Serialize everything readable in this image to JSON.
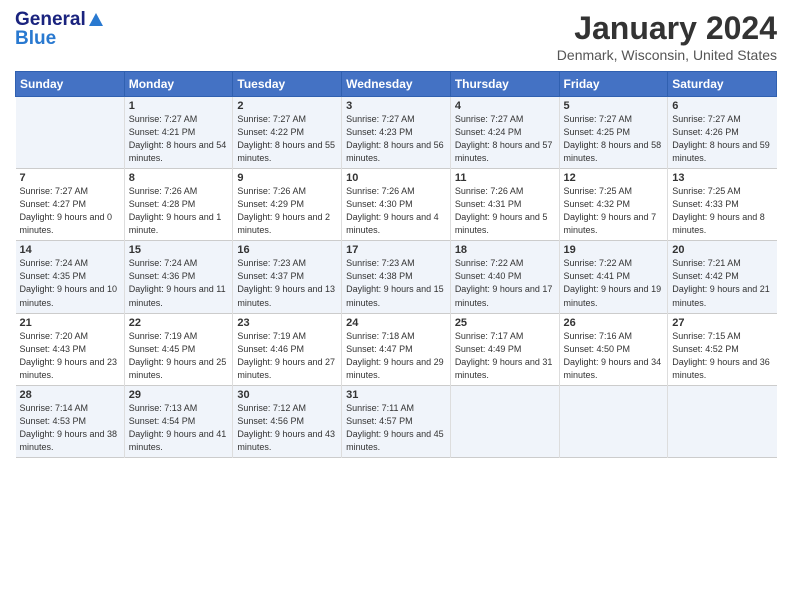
{
  "logo": {
    "line1": "General",
    "line2": "Blue"
  },
  "title": "January 2024",
  "subtitle": "Denmark, Wisconsin, United States",
  "days_header": [
    "Sunday",
    "Monday",
    "Tuesday",
    "Wednesday",
    "Thursday",
    "Friday",
    "Saturday"
  ],
  "weeks": [
    [
      {
        "num": "",
        "sunrise": "",
        "sunset": "",
        "daylight": ""
      },
      {
        "num": "1",
        "sunrise": "Sunrise: 7:27 AM",
        "sunset": "Sunset: 4:21 PM",
        "daylight": "Daylight: 8 hours and 54 minutes."
      },
      {
        "num": "2",
        "sunrise": "Sunrise: 7:27 AM",
        "sunset": "Sunset: 4:22 PM",
        "daylight": "Daylight: 8 hours and 55 minutes."
      },
      {
        "num": "3",
        "sunrise": "Sunrise: 7:27 AM",
        "sunset": "Sunset: 4:23 PM",
        "daylight": "Daylight: 8 hours and 56 minutes."
      },
      {
        "num": "4",
        "sunrise": "Sunrise: 7:27 AM",
        "sunset": "Sunset: 4:24 PM",
        "daylight": "Daylight: 8 hours and 57 minutes."
      },
      {
        "num": "5",
        "sunrise": "Sunrise: 7:27 AM",
        "sunset": "Sunset: 4:25 PM",
        "daylight": "Daylight: 8 hours and 58 minutes."
      },
      {
        "num": "6",
        "sunrise": "Sunrise: 7:27 AM",
        "sunset": "Sunset: 4:26 PM",
        "daylight": "Daylight: 8 hours and 59 minutes."
      }
    ],
    [
      {
        "num": "7",
        "sunrise": "Sunrise: 7:27 AM",
        "sunset": "Sunset: 4:27 PM",
        "daylight": "Daylight: 9 hours and 0 minutes."
      },
      {
        "num": "8",
        "sunrise": "Sunrise: 7:26 AM",
        "sunset": "Sunset: 4:28 PM",
        "daylight": "Daylight: 9 hours and 1 minute."
      },
      {
        "num": "9",
        "sunrise": "Sunrise: 7:26 AM",
        "sunset": "Sunset: 4:29 PM",
        "daylight": "Daylight: 9 hours and 2 minutes."
      },
      {
        "num": "10",
        "sunrise": "Sunrise: 7:26 AM",
        "sunset": "Sunset: 4:30 PM",
        "daylight": "Daylight: 9 hours and 4 minutes."
      },
      {
        "num": "11",
        "sunrise": "Sunrise: 7:26 AM",
        "sunset": "Sunset: 4:31 PM",
        "daylight": "Daylight: 9 hours and 5 minutes."
      },
      {
        "num": "12",
        "sunrise": "Sunrise: 7:25 AM",
        "sunset": "Sunset: 4:32 PM",
        "daylight": "Daylight: 9 hours and 7 minutes."
      },
      {
        "num": "13",
        "sunrise": "Sunrise: 7:25 AM",
        "sunset": "Sunset: 4:33 PM",
        "daylight": "Daylight: 9 hours and 8 minutes."
      }
    ],
    [
      {
        "num": "14",
        "sunrise": "Sunrise: 7:24 AM",
        "sunset": "Sunset: 4:35 PM",
        "daylight": "Daylight: 9 hours and 10 minutes."
      },
      {
        "num": "15",
        "sunrise": "Sunrise: 7:24 AM",
        "sunset": "Sunset: 4:36 PM",
        "daylight": "Daylight: 9 hours and 11 minutes."
      },
      {
        "num": "16",
        "sunrise": "Sunrise: 7:23 AM",
        "sunset": "Sunset: 4:37 PM",
        "daylight": "Daylight: 9 hours and 13 minutes."
      },
      {
        "num": "17",
        "sunrise": "Sunrise: 7:23 AM",
        "sunset": "Sunset: 4:38 PM",
        "daylight": "Daylight: 9 hours and 15 minutes."
      },
      {
        "num": "18",
        "sunrise": "Sunrise: 7:22 AM",
        "sunset": "Sunset: 4:40 PM",
        "daylight": "Daylight: 9 hours and 17 minutes."
      },
      {
        "num": "19",
        "sunrise": "Sunrise: 7:22 AM",
        "sunset": "Sunset: 4:41 PM",
        "daylight": "Daylight: 9 hours and 19 minutes."
      },
      {
        "num": "20",
        "sunrise": "Sunrise: 7:21 AM",
        "sunset": "Sunset: 4:42 PM",
        "daylight": "Daylight: 9 hours and 21 minutes."
      }
    ],
    [
      {
        "num": "21",
        "sunrise": "Sunrise: 7:20 AM",
        "sunset": "Sunset: 4:43 PM",
        "daylight": "Daylight: 9 hours and 23 minutes."
      },
      {
        "num": "22",
        "sunrise": "Sunrise: 7:19 AM",
        "sunset": "Sunset: 4:45 PM",
        "daylight": "Daylight: 9 hours and 25 minutes."
      },
      {
        "num": "23",
        "sunrise": "Sunrise: 7:19 AM",
        "sunset": "Sunset: 4:46 PM",
        "daylight": "Daylight: 9 hours and 27 minutes."
      },
      {
        "num": "24",
        "sunrise": "Sunrise: 7:18 AM",
        "sunset": "Sunset: 4:47 PM",
        "daylight": "Daylight: 9 hours and 29 minutes."
      },
      {
        "num": "25",
        "sunrise": "Sunrise: 7:17 AM",
        "sunset": "Sunset: 4:49 PM",
        "daylight": "Daylight: 9 hours and 31 minutes."
      },
      {
        "num": "26",
        "sunrise": "Sunrise: 7:16 AM",
        "sunset": "Sunset: 4:50 PM",
        "daylight": "Daylight: 9 hours and 34 minutes."
      },
      {
        "num": "27",
        "sunrise": "Sunrise: 7:15 AM",
        "sunset": "Sunset: 4:52 PM",
        "daylight": "Daylight: 9 hours and 36 minutes."
      }
    ],
    [
      {
        "num": "28",
        "sunrise": "Sunrise: 7:14 AM",
        "sunset": "Sunset: 4:53 PM",
        "daylight": "Daylight: 9 hours and 38 minutes."
      },
      {
        "num": "29",
        "sunrise": "Sunrise: 7:13 AM",
        "sunset": "Sunset: 4:54 PM",
        "daylight": "Daylight: 9 hours and 41 minutes."
      },
      {
        "num": "30",
        "sunrise": "Sunrise: 7:12 AM",
        "sunset": "Sunset: 4:56 PM",
        "daylight": "Daylight: 9 hours and 43 minutes."
      },
      {
        "num": "31",
        "sunrise": "Sunrise: 7:11 AM",
        "sunset": "Sunset: 4:57 PM",
        "daylight": "Daylight: 9 hours and 45 minutes."
      },
      {
        "num": "",
        "sunrise": "",
        "sunset": "",
        "daylight": ""
      },
      {
        "num": "",
        "sunrise": "",
        "sunset": "",
        "daylight": ""
      },
      {
        "num": "",
        "sunrise": "",
        "sunset": "",
        "daylight": ""
      }
    ]
  ]
}
